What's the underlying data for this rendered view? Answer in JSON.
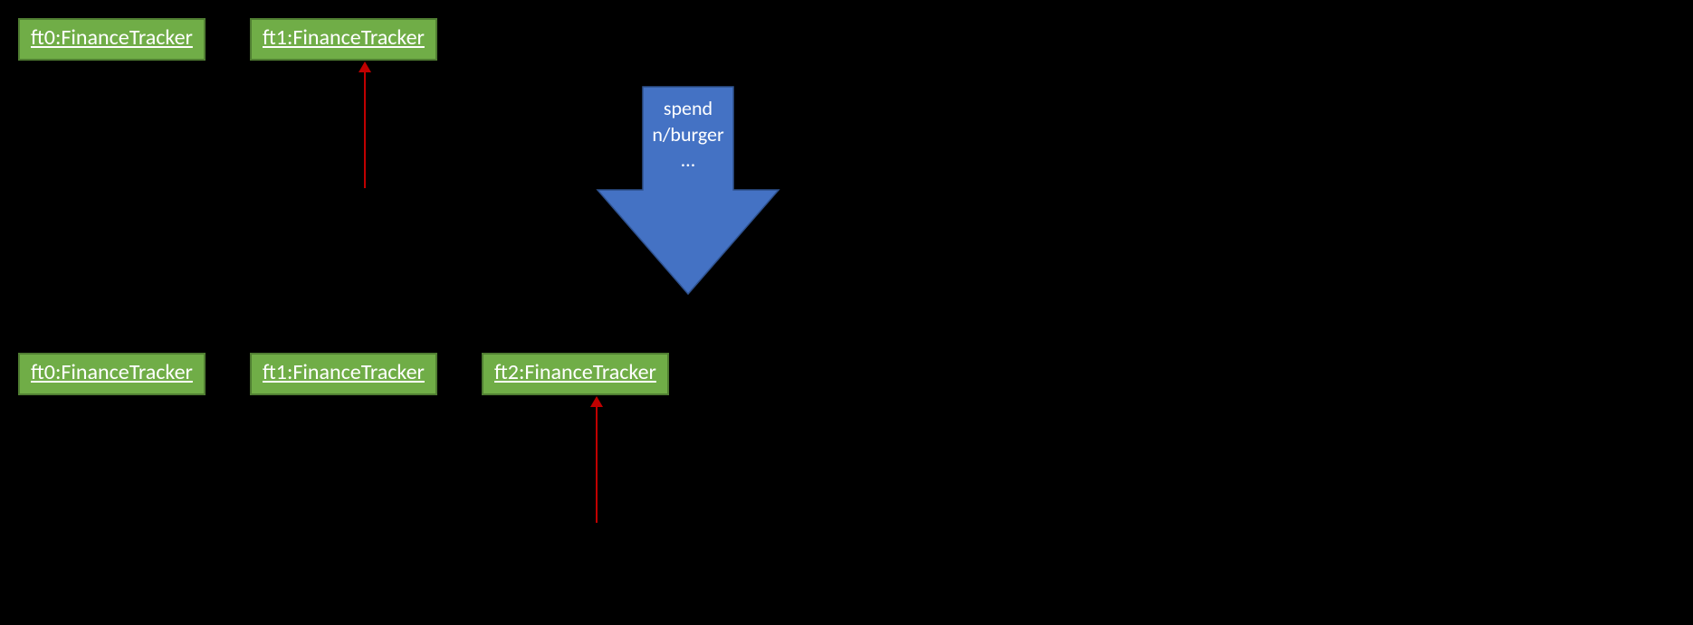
{
  "top_row": {
    "ft0": "ft0:FinanceTracker",
    "ft1": "ft1:FinanceTracker"
  },
  "bottom_row": {
    "ft0": "ft0:FinanceTracker",
    "ft1": "ft1:FinanceTracker",
    "ft2": "ft2:FinanceTracker"
  },
  "transition_arrow": {
    "line1": "spend",
    "line2": "n/burger",
    "line3": "…"
  },
  "colors": {
    "object_fill": "#70AD47",
    "object_border": "#507E32",
    "arrow_blue_fill": "#4472C4",
    "arrow_blue_border": "#2F528F",
    "pointer_red": "#C00000",
    "background": "#000000",
    "text": "#FFFFFF"
  }
}
